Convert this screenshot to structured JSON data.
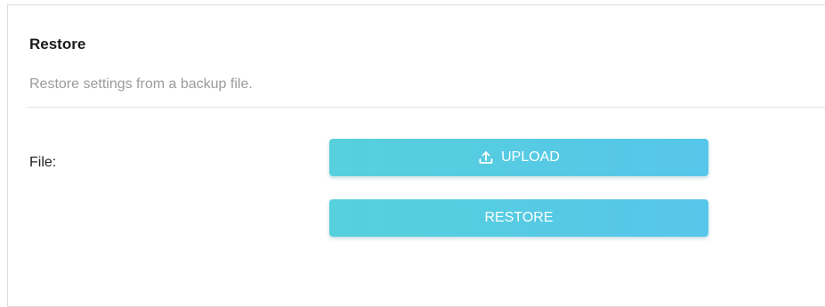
{
  "section": {
    "title": "Restore",
    "description": "Restore settings from a backup file."
  },
  "file_field": {
    "label": "File:"
  },
  "buttons": {
    "upload_label": "UPLOAD",
    "upload_icon": "upload-icon",
    "restore_label": "RESTORE"
  },
  "colors": {
    "button_gradient_start": "#56d0dc",
    "button_gradient_end": "#56c6ea",
    "button_text": "#ffffff",
    "subtitle_text": "#9b9b9b"
  }
}
